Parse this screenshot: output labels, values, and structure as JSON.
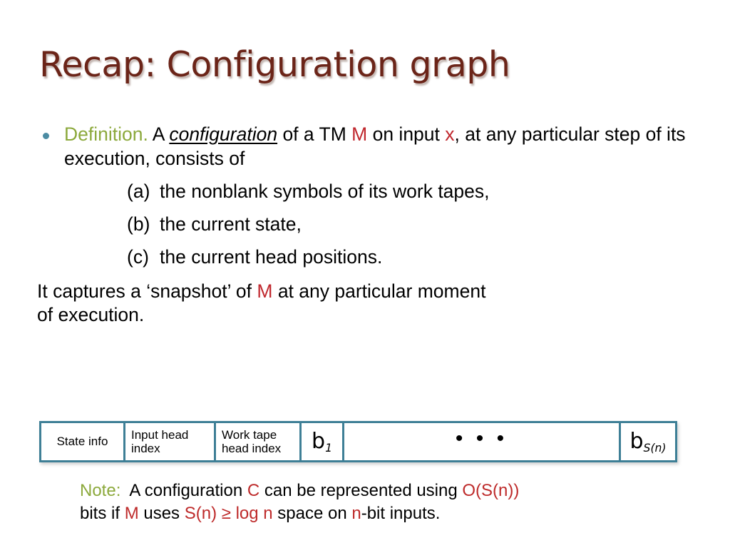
{
  "slide": {
    "title": "Recap: Configuration graph",
    "colors": {
      "title": "#6B2418",
      "accent_green": "#8CA93C",
      "accent_red": "#BE2B2B",
      "bullet_teal": "#4C8CA3",
      "strip_border": "#3E7F96",
      "background": "#FFFFFF"
    }
  },
  "definition": {
    "label": "Definition.",
    "t1": "A ",
    "term": "configuration",
    "t2": " of a TM ",
    "machine": "M",
    "t3": " on input ",
    "input": "x",
    "t4": ", at any particular step of its execution, consists of"
  },
  "sub_items": [
    {
      "label": "(a)",
      "text": "the nonblank symbols of its work tapes,"
    },
    {
      "label": "(b)",
      "text": "the current state,"
    },
    {
      "label": "(c)",
      "text": "the current head positions."
    }
  ],
  "captures": {
    "t1": "It captures a ‘snapshot’ of ",
    "machine": "M",
    "t2": " at any particular moment",
    "line2": "of execution."
  },
  "config_strip": {
    "cells": [
      {
        "name": "state-info",
        "text": "State info"
      },
      {
        "name": "input-head-index",
        "line1": "Input head",
        "line2": "index"
      },
      {
        "name": "work-tape-head-index",
        "line1": "Work tape",
        "line2": "head index"
      },
      {
        "name": "b-first",
        "base": "b",
        "sub": "1"
      },
      {
        "name": "ellipsis",
        "text": "• • •"
      },
      {
        "name": "b-last",
        "base": "b",
        "sub": "S(n)"
      }
    ]
  },
  "note": {
    "label": "Note:",
    "t1": "A configuration ",
    "config_var": "C",
    "t2": " can be represented using ",
    "bigo": "O(S(n))",
    "t3": "bits if ",
    "machine": "M",
    "t4": " uses ",
    "bound": "S(n) ≥ log n",
    "t5": " space on ",
    "n_var": "n",
    "t6": "-bit inputs."
  }
}
